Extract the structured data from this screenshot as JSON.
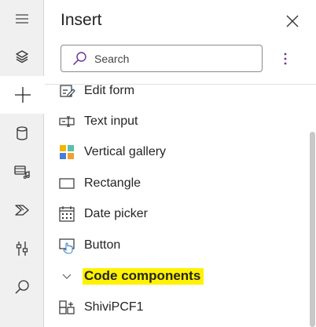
{
  "panel": {
    "title": "Insert",
    "search": {
      "placeholder": "Search",
      "value": ""
    }
  },
  "rail": {
    "items": [
      {
        "icon": "hamburger-menu-icon"
      },
      {
        "icon": "layers-icon"
      },
      {
        "icon": "plus-icon",
        "active": true
      },
      {
        "icon": "data-cylinder-icon"
      },
      {
        "icon": "media-icon"
      },
      {
        "icon": "power-automate-icon"
      },
      {
        "icon": "advanced-tools-icon"
      },
      {
        "icon": "search-icon"
      }
    ]
  },
  "items": [
    {
      "label": "Edit form",
      "icon": "edit-form-icon"
    },
    {
      "label": "Text input",
      "icon": "text-input-icon"
    },
    {
      "label": "Vertical gallery",
      "icon": "vertical-gallery-icon"
    },
    {
      "label": "Rectangle",
      "icon": "rectangle-icon"
    },
    {
      "label": "Date picker",
      "icon": "date-picker-icon"
    },
    {
      "label": "Button",
      "icon": "button-icon"
    }
  ],
  "section": {
    "label": "Code components",
    "expanded": true
  },
  "section_items": [
    {
      "label": "ShiviPCF1",
      "icon": "code-component-icon"
    }
  ],
  "colors": {
    "accent": "#6b2fa0",
    "highlight": "#fff200",
    "rail_bg": "#f0f0f0",
    "gallery_colors": [
      "#f4b400",
      "#5ac0a8",
      "#4a7fd0",
      "#f0a030"
    ]
  }
}
